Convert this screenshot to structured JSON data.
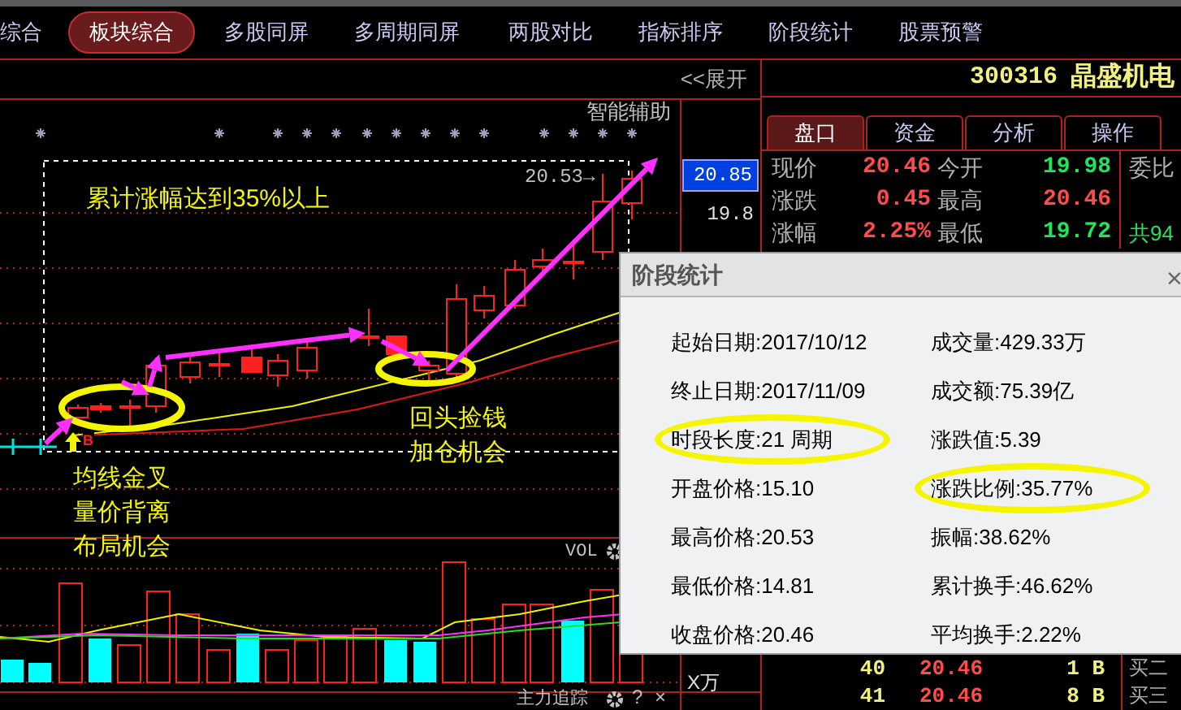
{
  "top_tabs": [
    {
      "label": "综合",
      "selected": false
    },
    {
      "label": "板块综合",
      "selected": true
    },
    {
      "label": "多股同屏",
      "selected": false
    },
    {
      "label": "多周期同屏",
      "selected": false
    },
    {
      "label": "两股对比",
      "selected": false
    },
    {
      "label": "指标排序",
      "selected": false
    },
    {
      "label": "阶段统计",
      "selected": false
    },
    {
      "label": "股票预警",
      "selected": false
    }
  ],
  "expand_button": "<<展开",
  "chart": {
    "helper_label": "智能辅助",
    "high_marker": "20.53→",
    "annotation": "累计涨幅达到35%以上",
    "buy_marker": "B",
    "callouts": [
      {
        "lines": [
          "均线金叉",
          "量价背离",
          "布局机会"
        ]
      },
      {
        "lines": [
          "回头捡钱",
          "加仓机会"
        ]
      }
    ],
    "price_axis": [
      {
        "text": "20.85",
        "selected": true
      },
      {
        "text": "19.8",
        "selected": false
      }
    ]
  },
  "volume_panel": {
    "label": "VOL",
    "unit": "X万",
    "footer_label": "主力追踪",
    "footer_buttons": [
      "?",
      "×"
    ]
  },
  "quote_panel": {
    "code": "300316",
    "name": "晶盛机电",
    "tabs": [
      {
        "label": "盘口",
        "selected": true
      },
      {
        "label": "资金",
        "selected": false
      },
      {
        "label": "分析",
        "selected": false
      },
      {
        "label": "操作",
        "selected": false
      }
    ],
    "rows": [
      {
        "cells": [
          {
            "label": "现价",
            "value": "20.46",
            "color": "#ff4b4b"
          },
          {
            "label": "今开",
            "value": "19.98",
            "color": "#22e35a"
          }
        ]
      },
      {
        "cells": [
          {
            "label": "涨跌",
            "value": "0.45",
            "color": "#ff4b4b"
          },
          {
            "label": "最高",
            "value": "20.46",
            "color": "#ff4b4b"
          }
        ]
      },
      {
        "cells": [
          {
            "label": "涨幅",
            "value": "2.25%",
            "color": "#ff4b4b"
          },
          {
            "label": "最低",
            "value": "19.72",
            "color": "#22e35a"
          }
        ]
      }
    ],
    "side_label": "委比",
    "side_note": "共94"
  },
  "book_labels": [
    "买二",
    "买三"
  ],
  "order_book": [
    {
      "index": "40",
      "price": "20.46",
      "volume": "1 B"
    },
    {
      "index": "41",
      "price": "20.46",
      "volume": "8 B"
    }
  ],
  "dialog": {
    "title": "阶段统计",
    "close": "×",
    "left_column": [
      {
        "text": "起始日期:2017/10/12",
        "highlighted": false
      },
      {
        "text": "终止日期:2017/11/09",
        "highlighted": false
      },
      {
        "text": "时段长度:21 周期",
        "highlighted": true
      },
      {
        "text": "开盘价格:15.10",
        "highlighted": false
      },
      {
        "text": "最高价格:20.53",
        "highlighted": false
      },
      {
        "text": "最低价格:14.81",
        "highlighted": false
      },
      {
        "text": "收盘价格:20.46",
        "highlighted": false
      }
    ],
    "right_column": [
      {
        "text": "成交量:429.33万",
        "highlighted": false
      },
      {
        "text": "成交额:75.39亿",
        "highlighted": false
      },
      {
        "text": "涨跌值:5.39",
        "highlighted": false
      },
      {
        "text": "涨跌比例:35.77%",
        "highlighted": true
      },
      {
        "text": "振幅:38.62%",
        "highlighted": false
      },
      {
        "text": "累计换手:46.62%",
        "highlighted": false
      },
      {
        "text": "平均换手:2.22%",
        "highlighted": false
      }
    ]
  }
}
